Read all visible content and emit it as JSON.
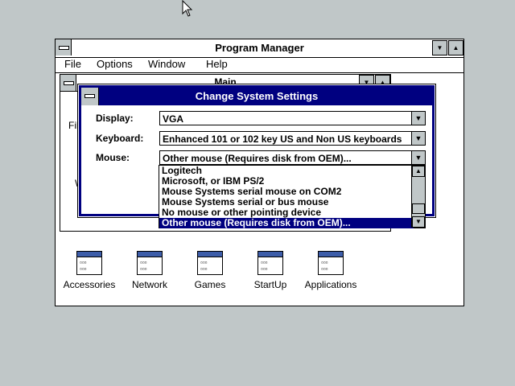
{
  "program_manager": {
    "title": "Program Manager",
    "menu": [
      {
        "label": "File"
      },
      {
        "label": "Options"
      },
      {
        "label": "Window"
      },
      {
        "label": "Help"
      }
    ]
  },
  "main_group": {
    "title": "Main",
    "fragment_file": "Fil",
    "fragment_w": "W"
  },
  "groups": [
    {
      "label": "Accessories",
      "icon": "program-group-icon"
    },
    {
      "label": "Network",
      "icon": "program-group-icon"
    },
    {
      "label": "Games",
      "icon": "program-group-icon"
    },
    {
      "label": "StartUp",
      "icon": "program-group-icon"
    },
    {
      "label": "Applications",
      "icon": "program-group-icon"
    }
  ],
  "dialog": {
    "title": "Change System Settings",
    "fields": {
      "display": {
        "label": "Display:",
        "value": "VGA"
      },
      "keyboard": {
        "label": "Keyboard:",
        "value": "Enhanced 101 or 102 key US and Non US keyboards"
      },
      "mouse": {
        "label": "Mouse:",
        "value": "Other mouse (Requires disk from OEM)..."
      }
    },
    "mouse_options": [
      "Logitech",
      "Microsoft, or IBM PS/2",
      "Mouse Systems serial mouse on COM2",
      "Mouse Systems serial or bus mouse",
      "No mouse or other pointing device",
      "Other mouse (Requires disk from OEM)..."
    ],
    "selected_index": 5
  },
  "colors": {
    "desktop": "#c0c7c8",
    "title_active": "#000080",
    "selection": "#000080",
    "window": "#ffffff"
  }
}
